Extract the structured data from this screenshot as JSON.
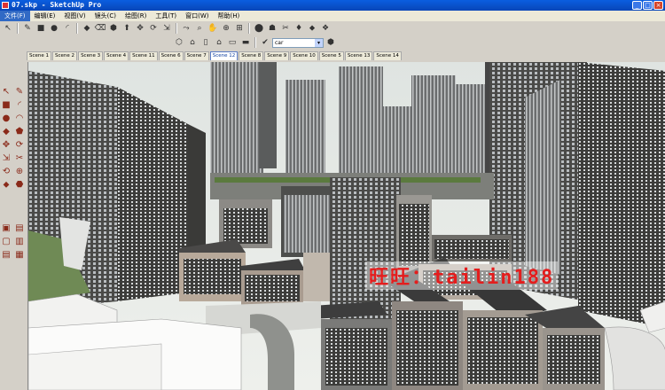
{
  "window": {
    "title": "07.skp - SketchUp Pro",
    "min": "_",
    "max": "□",
    "close": "×"
  },
  "menu": [
    "文件(F)",
    "编辑(E)",
    "视图(V)",
    "镜头(C)",
    "绘图(R)",
    "工具(T)",
    "窗口(W)",
    "帮助(H)"
  ],
  "layer": {
    "value": "car",
    "arrow": "▾"
  },
  "tabs": [
    {
      "label": "Scene 1",
      "active": false
    },
    {
      "label": "Scene 2",
      "active": false
    },
    {
      "label": "Scene 3",
      "active": false
    },
    {
      "label": "Scene 4",
      "active": false
    },
    {
      "label": "Scene 11",
      "active": false
    },
    {
      "label": "Scene 6",
      "active": false
    },
    {
      "label": "Scene 7",
      "active": false
    },
    {
      "label": "Scene 12",
      "active": true
    },
    {
      "label": "Scene 8",
      "active": false
    },
    {
      "label": "Scene 9",
      "active": false
    },
    {
      "label": "Scene 10",
      "active": false
    },
    {
      "label": "Scene 5",
      "active": false
    },
    {
      "label": "Scene 13",
      "active": false
    },
    {
      "label": "Scene 14",
      "active": false
    }
  ],
  "toolbar1": [
    "↖",
    "✎",
    "■",
    "●",
    "◜",
    "◆",
    "⌫",
    "⬢",
    "⬆",
    "✥",
    "⟳",
    "⇲",
    "⤳",
    "⌕",
    "✋",
    "⊕",
    "⊞",
    "⬤",
    "☗",
    "✂",
    "♦",
    "⬥",
    "❖"
  ],
  "toolbar2": [
    "⬡",
    "⌂",
    "▯",
    "⌂",
    "▭",
    "▬"
  ],
  "lefttools": [
    [
      "↖",
      "✎"
    ],
    [
      "■",
      "◜"
    ],
    [
      "●",
      "◠"
    ],
    [
      "◆",
      "⬟"
    ],
    [
      "✥",
      "⟳"
    ],
    [
      "⇲",
      "✂"
    ],
    [
      "⟲",
      "⊕"
    ],
    [
      "⬥",
      "⬣"
    ]
  ],
  "lefttools2": [
    [
      "▣",
      "▤"
    ],
    [
      "▢",
      "▥"
    ],
    [
      "▤",
      "▦"
    ]
  ],
  "watermark": "旺旺：tailin188"
}
